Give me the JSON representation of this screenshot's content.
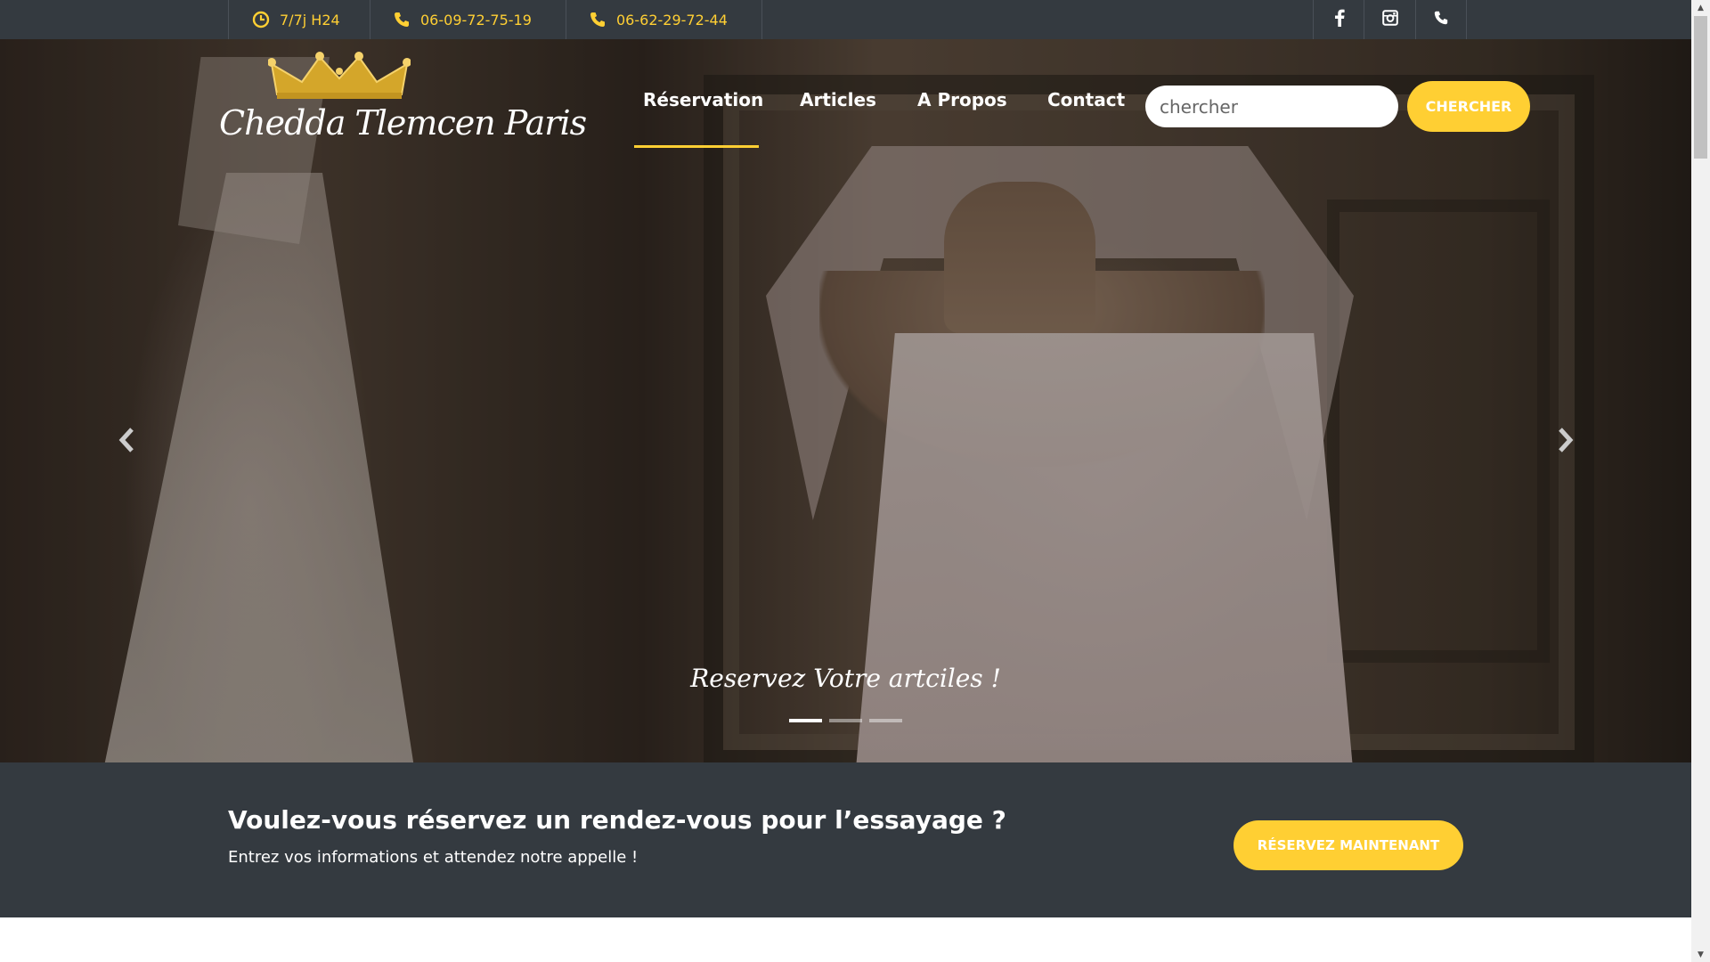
{
  "topbar": {
    "hours": "7/7j H24",
    "phone1": "06-09-72-75-19",
    "phone2": "06-62-29-72-44",
    "accent_color": "#ffcf33",
    "social_icons": [
      "facebook-icon",
      "instagram-icon",
      "phone-icon"
    ]
  },
  "logo": {
    "text": "Chedda Tlemcen Paris"
  },
  "nav": {
    "items": [
      {
        "label": "Réservation",
        "active": true
      },
      {
        "label": "Articles"
      },
      {
        "label": "A Propos"
      },
      {
        "label": "Contact"
      }
    ]
  },
  "search": {
    "placeholder": "chercher",
    "button_label": "CHERCHER"
  },
  "carousel": {
    "caption": "Reservez Votre artciles !",
    "slide_count": 3,
    "active_slide": 1,
    "arrows": [
      "chevron-left-icon",
      "chevron-right-icon"
    ]
  },
  "cta": {
    "title": "Voulez-vous réservez un rendez-vous pour l’essayage ?",
    "subtitle": "Entrez vos informations et attendez notre appelle !",
    "button_label": "RÉSERVEZ MAINTENANT",
    "band_color": "#343a40"
  }
}
